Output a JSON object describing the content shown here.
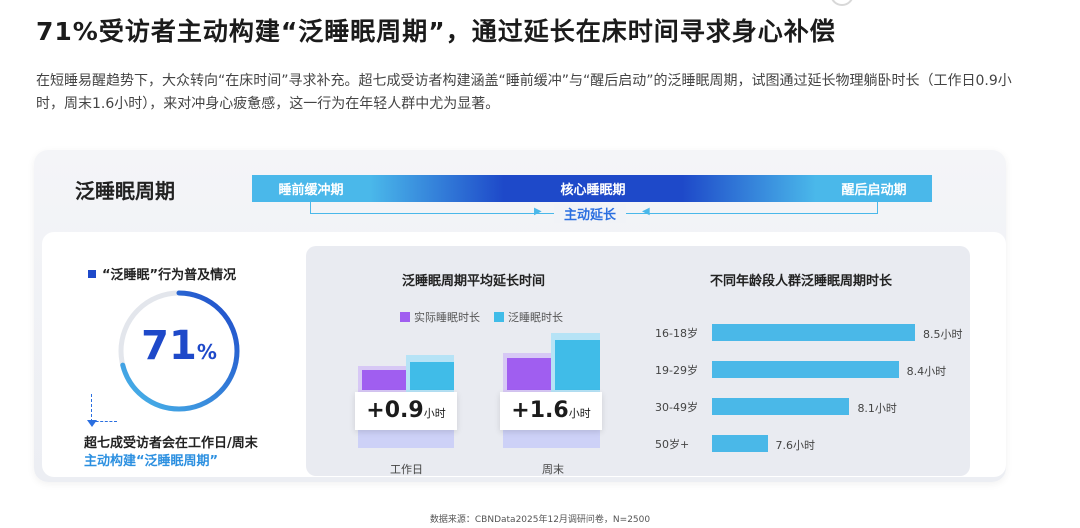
{
  "title": "71%受访者主动构建“泛睡眠周期”，通过延长在床时间寻求身心补偿",
  "intro": "在短睡易醒趋势下，大众转向“在床时间”寻求补充。超七成受访者构建涵盖“睡前缓冲”与“醒后启动”的泛睡眠周期，试图通过延长物理躺卧时长（工作日0.9小时，周末1.6小时），来对冲身心疲惫感，这一行为在年轻人群中尤为显著。",
  "cycle": {
    "title": "泛睡眠周期",
    "pre": "睡前缓冲期",
    "core": "核心睡眠期",
    "post": "醒后启动期",
    "extension": "主动延长"
  },
  "prevalence": {
    "title": "“泛睡眠”行为普及情况",
    "value": "71",
    "unit": "%",
    "fraction": 0.71,
    "note_line1": "超七成受访者会在工作日/周末",
    "note_line2": "主动构建“泛睡眠周期”"
  },
  "colors": {
    "brand_blue": "#1e49c9",
    "light_blue": "#4ab8ea",
    "purple": "#a05ef0",
    "teal": "#40bce8"
  },
  "chart_data": [
    {
      "type": "bar",
      "title": "泛睡眠周期平均延长时间",
      "categories": [
        "工作日",
        "周末"
      ],
      "series": [
        {
          "name": "实际睡眠时长",
          "color": "#a05ef0"
        },
        {
          "name": "泛睡眠时长",
          "color": "#40bce8"
        }
      ],
      "extension_values": [
        0.9,
        1.6
      ],
      "extension_labels": [
        "+0.9",
        "+1.6"
      ],
      "unit": "小时"
    },
    {
      "type": "bar",
      "orientation": "horizontal",
      "title": "不同年龄段人群泛睡眠周期时长",
      "categories": [
        "16-18岁",
        "19-29岁",
        "30-49岁",
        "50岁+"
      ],
      "values": [
        8.5,
        8.4,
        8.1,
        7.6
      ],
      "value_labels": [
        "8.5小时",
        "8.4小时",
        "8.1小时",
        "7.6小时"
      ],
      "unit": "小时"
    }
  ],
  "source": "数据来源：CBNData2025年12月调研问卷，N=2500"
}
